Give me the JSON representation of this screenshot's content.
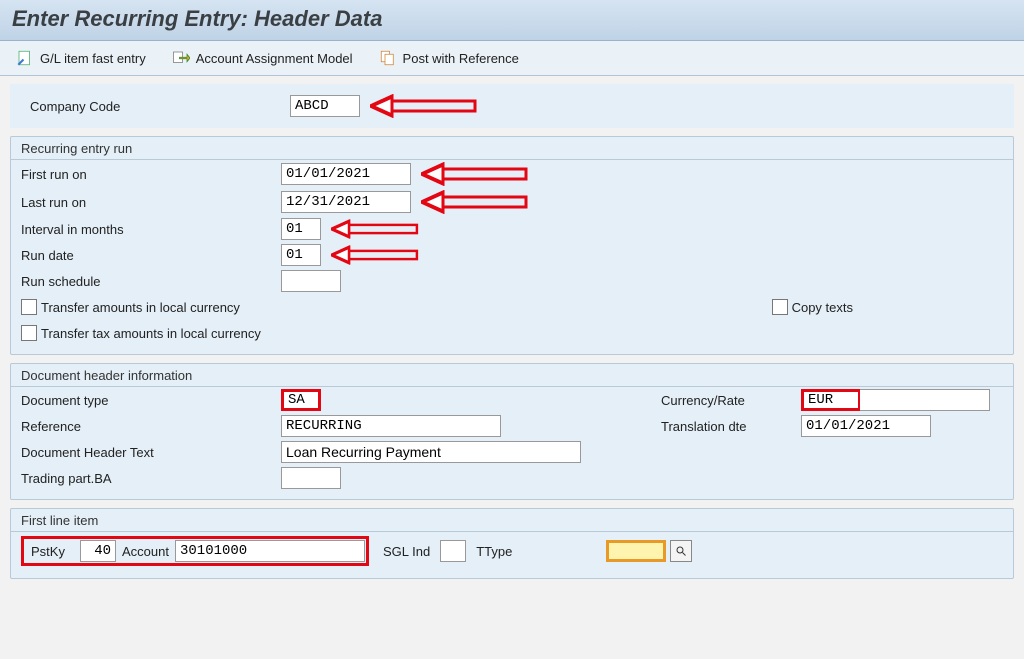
{
  "title": "Enter Recurring Entry: Header Data",
  "toolbar": {
    "fast_entry": "G/L item fast entry",
    "acct_model": "Account Assignment Model",
    "post_ref": "Post with Reference"
  },
  "company_code": {
    "label": "Company Code",
    "value": "ABCD"
  },
  "recurring": {
    "title": "Recurring entry run",
    "first_run": {
      "label": "First run on",
      "value": "01/01/2021"
    },
    "last_run": {
      "label": "Last run on",
      "value": "12/31/2021"
    },
    "interval": {
      "label": "Interval in months",
      "value": "01"
    },
    "run_date": {
      "label": "Run date",
      "value": "01"
    },
    "run_schedule": {
      "label": "Run schedule",
      "value": ""
    },
    "transfer_local": "Transfer amounts in local currency",
    "transfer_tax": "Transfer tax amounts in local currency",
    "copy_texts": "Copy texts"
  },
  "doc_header": {
    "title": "Document header information",
    "doc_type": {
      "label": "Document type",
      "value": "SA"
    },
    "currency": {
      "label": "Currency/Rate",
      "value": "EUR"
    },
    "reference": {
      "label": "Reference",
      "value": "RECURRING"
    },
    "translation_dte": {
      "label": "Translation dte",
      "value": "01/01/2021"
    },
    "header_text": {
      "label": "Document Header Text",
      "value": "Loan Recurring Payment"
    },
    "trading_ba": {
      "label": "Trading part.BA",
      "value": ""
    }
  },
  "line_item": {
    "title": "First line item",
    "pstky": {
      "label": "PstKy",
      "value": "40"
    },
    "account": {
      "label": "Account",
      "value": "30101000"
    },
    "sgl_ind": {
      "label": "SGL Ind",
      "value": ""
    },
    "ttype": {
      "label": "TType",
      "value": ""
    }
  }
}
